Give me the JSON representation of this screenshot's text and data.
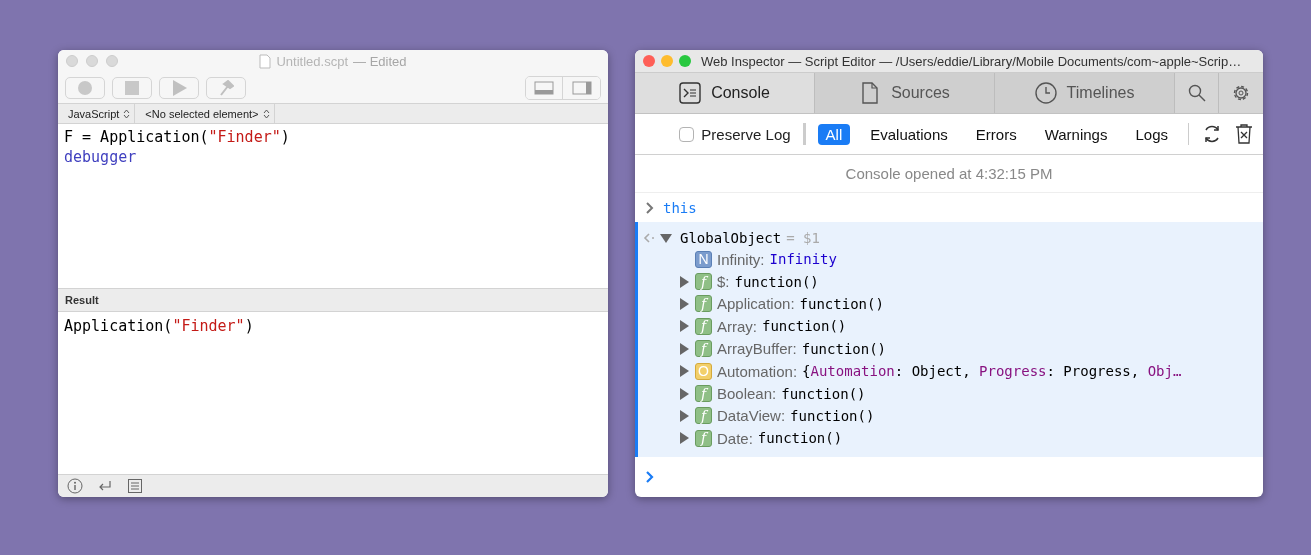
{
  "editor_window": {
    "title": "Untitled.scpt",
    "title_status": "— Edited",
    "language": "JavaScript",
    "element_selector": "<No selected element>",
    "code_lines": [
      [
        {
          "text": "F = Application(",
          "kind": "plain"
        },
        {
          "text": "\"Finder\"",
          "kind": "string"
        },
        {
          "text": ")",
          "kind": "plain"
        }
      ],
      [
        {
          "text": "debugger",
          "kind": "keyword"
        }
      ]
    ],
    "result_label": "Result",
    "result_lines": [
      [
        {
          "text": "Application(",
          "kind": "plain"
        },
        {
          "text": "\"Finder\"",
          "kind": "string"
        },
        {
          "text": ")",
          "kind": "plain"
        }
      ]
    ]
  },
  "inspector_window": {
    "title": "Web Inspector — Script Editor — /Users/eddie/Library/Mobile Documents/com~apple~Scrip…",
    "tabs": [
      {
        "label": "Console",
        "kind": "console",
        "selected": true
      },
      {
        "label": "Sources",
        "kind": "sources",
        "selected": false
      },
      {
        "label": "Timelines",
        "kind": "timelines",
        "selected": false
      }
    ],
    "preserve_log": {
      "label": "Preserve Log",
      "checked": false
    },
    "filters": [
      {
        "label": "All",
        "selected": true
      },
      {
        "label": "Evaluations",
        "selected": false
      },
      {
        "label": "Errors",
        "selected": false
      },
      {
        "label": "Warnings",
        "selected": false
      },
      {
        "label": "Logs",
        "selected": false
      }
    ],
    "console_message": "Console opened at 4:32:15 PM",
    "input_command": "this",
    "result": {
      "name": "GlobalObject",
      "equals": "=",
      "ref": "$1",
      "expanded": true,
      "children": [
        {
          "badge": "N",
          "kind": "number",
          "expandable": false,
          "name": "Infinity:",
          "value": [
            {
              "text": "Infinity",
              "kind": "number"
            }
          ]
        },
        {
          "badge": "f",
          "kind": "function",
          "expandable": true,
          "name": "$:",
          "value": [
            {
              "text": "function()",
              "kind": "plain"
            }
          ]
        },
        {
          "badge": "f",
          "kind": "function",
          "expandable": true,
          "name": "Application:",
          "value": [
            {
              "text": "function()",
              "kind": "plain"
            }
          ]
        },
        {
          "badge": "f",
          "kind": "function",
          "expandable": true,
          "name": "Array:",
          "value": [
            {
              "text": "function()",
              "kind": "plain"
            }
          ]
        },
        {
          "badge": "f",
          "kind": "function",
          "expandable": true,
          "name": "ArrayBuffer:",
          "value": [
            {
              "text": "function()",
              "kind": "plain"
            }
          ]
        },
        {
          "badge": "O",
          "kind": "object",
          "expandable": true,
          "name": "Automation:",
          "value": [
            {
              "text": "{",
              "kind": "plain"
            },
            {
              "text": "Automation",
              "kind": "key"
            },
            {
              "text": ": Object, ",
              "kind": "plain"
            },
            {
              "text": "Progress",
              "kind": "key"
            },
            {
              "text": ": Progress, ",
              "kind": "plain"
            },
            {
              "text": "Obj…",
              "kind": "key"
            }
          ]
        },
        {
          "badge": "f",
          "kind": "function",
          "expandable": true,
          "name": "Boolean:",
          "value": [
            {
              "text": "function()",
              "kind": "plain"
            }
          ]
        },
        {
          "badge": "f",
          "kind": "function",
          "expandable": true,
          "name": "DataView:",
          "value": [
            {
              "text": "function()",
              "kind": "plain"
            }
          ]
        },
        {
          "badge": "f",
          "kind": "function",
          "expandable": true,
          "name": "Date:",
          "value": [
            {
              "text": "function()",
              "kind": "plain"
            }
          ]
        }
      ]
    }
  }
}
